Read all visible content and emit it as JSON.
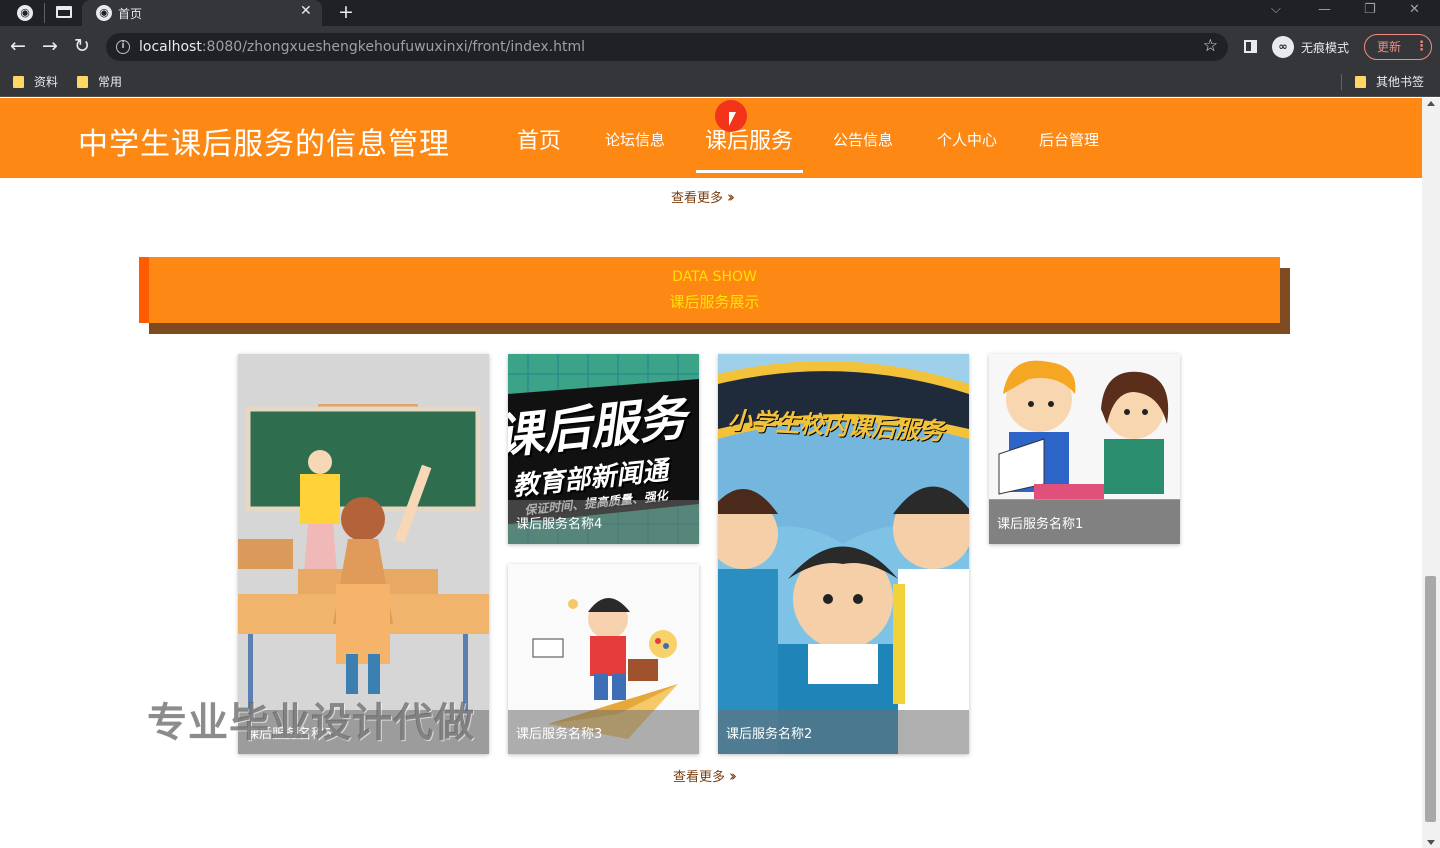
{
  "browser": {
    "tab_title": "首页",
    "url_host": "localhost",
    "url_rest": ":8080/zhongxueshengkehoufuwuxinxi/front/index.html",
    "incognito_label": "无痕模式",
    "update_label": "更新",
    "bookmarks": [
      "资料",
      "常用"
    ],
    "other_bookmarks": "其他书签"
  },
  "site": {
    "title": "中学生课后服务的信息管理",
    "nav": [
      "首页",
      "论坛信息",
      "课后服务",
      "公告信息",
      "个人中心",
      "后台管理"
    ],
    "active_nav": "课后服务",
    "accent_color": "#fd8814"
  },
  "more_top": "查看更多",
  "section": {
    "title_en": "DATA SHOW",
    "title_cn": "课后服务展示"
  },
  "cards": [
    {
      "caption": "课后服务名称5"
    },
    {
      "caption": "课后服务名称4",
      "poster_line1": "课后服务",
      "poster_line2": "教育部新闻通",
      "poster_line3": "保证时间、提高质量、强化"
    },
    {
      "caption": "课后服务名称3"
    },
    {
      "caption": "课后服务名称2",
      "poster_banner": "小学生校内课后服务"
    },
    {
      "caption": "课后服务名称1"
    }
  ],
  "more_bottom": "查看更多",
  "watermark": "专业毕业设计代做"
}
